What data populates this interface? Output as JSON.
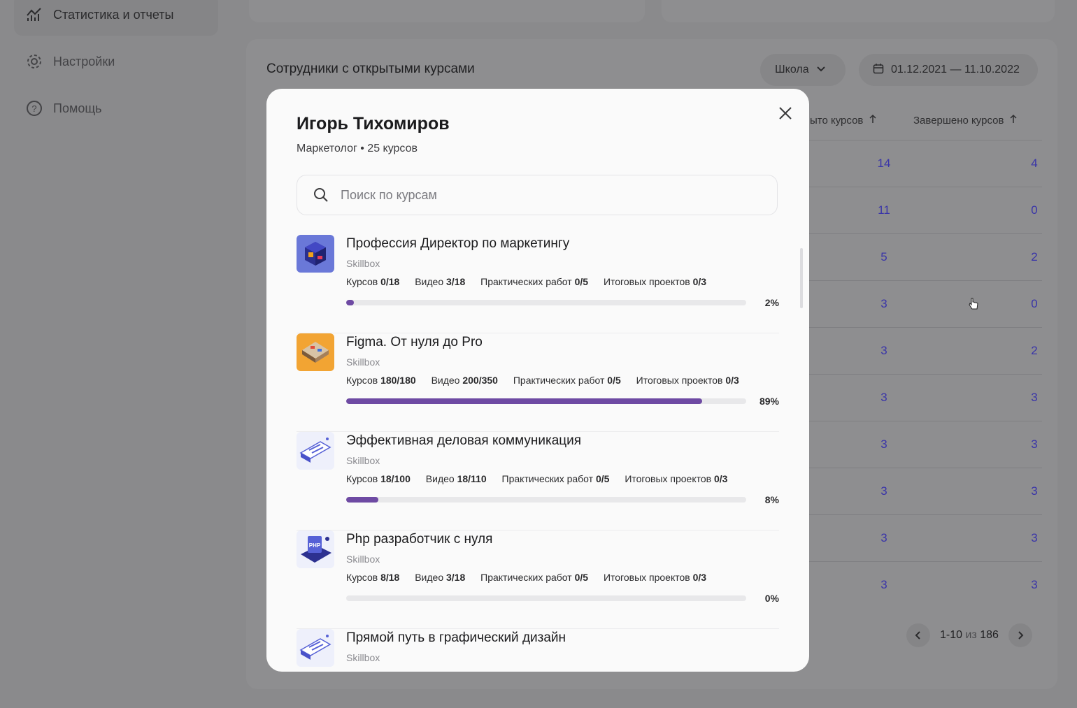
{
  "sidebar": {
    "items": [
      {
        "label": "Статистика и отчеты",
        "icon": "chart-icon"
      },
      {
        "label": "Настройки",
        "icon": "gear-icon"
      },
      {
        "label": "Помощь",
        "icon": "help-icon"
      }
    ]
  },
  "panel": {
    "title": "Сотрудники с открытыми курсами",
    "school_filter": "Школа",
    "date_range": "01.12.2021 — 11.10.2022",
    "columns": [
      "ыто курсов",
      "Завершено курсов"
    ],
    "rows": [
      [
        "14",
        "4"
      ],
      [
        "11",
        "0"
      ],
      [
        "5",
        "2"
      ],
      [
        "3",
        "0"
      ],
      [
        "3",
        "2"
      ],
      [
        "3",
        "3"
      ],
      [
        "3",
        "3"
      ],
      [
        "3",
        "3"
      ],
      [
        "3",
        "3"
      ],
      [
        "3",
        "3"
      ]
    ],
    "pagination": {
      "range": "1-10",
      "of": "из",
      "total": "186"
    }
  },
  "modal": {
    "name": "Игорь Тихомиров",
    "subtitle": "Маркетолог • 25 курсов",
    "search_placeholder": "Поиск по курсам",
    "courses": [
      {
        "title": "Профессия Директор по маркетингу",
        "school": "Skillbox",
        "stats": {
          "courses_label": "Курсов",
          "courses": "0/18",
          "video_label": "Видео",
          "video": "3/18",
          "practice_label": "Практических работ",
          "practice": "0/5",
          "final_label": "Итоговых проектов",
          "final": "0/3"
        },
        "progress": 2,
        "progress_label": "2%"
      },
      {
        "title": "Figma. От нуля до Pro",
        "school": "Skillbox",
        "stats": {
          "courses_label": "Курсов",
          "courses": "180/180",
          "video_label": "Видео",
          "video": "200/350",
          "practice_label": "Практических работ",
          "practice": "0/5",
          "final_label": "Итоговых проектов",
          "final": "0/3"
        },
        "progress": 89,
        "progress_label": "89%"
      },
      {
        "title": "Эффективная деловая коммуникация",
        "school": "Skillbox",
        "stats": {
          "courses_label": "Курсов",
          "courses": "18/100",
          "video_label": "Видео",
          "video": "18/110",
          "practice_label": "Практических работ",
          "practice": "0/5",
          "final_label": "Итоговых проектов",
          "final": "0/3"
        },
        "progress": 8,
        "progress_label": "8%"
      },
      {
        "title": "Php разработчик с нуля",
        "school": "Skillbox",
        "stats": {
          "courses_label": "Курсов",
          "courses": "8/18",
          "video_label": "Видео",
          "video": "3/18",
          "practice_label": "Практических работ",
          "practice": "0/5",
          "final_label": "Итоговых проектов",
          "final": "0/3"
        },
        "progress": 0,
        "progress_label": "0%"
      },
      {
        "title": "Прямой путь в графический дизайн",
        "school": "Skillbox"
      }
    ]
  },
  "colors": {
    "accent": "#6e4aa3",
    "link": "#3a35a8"
  }
}
